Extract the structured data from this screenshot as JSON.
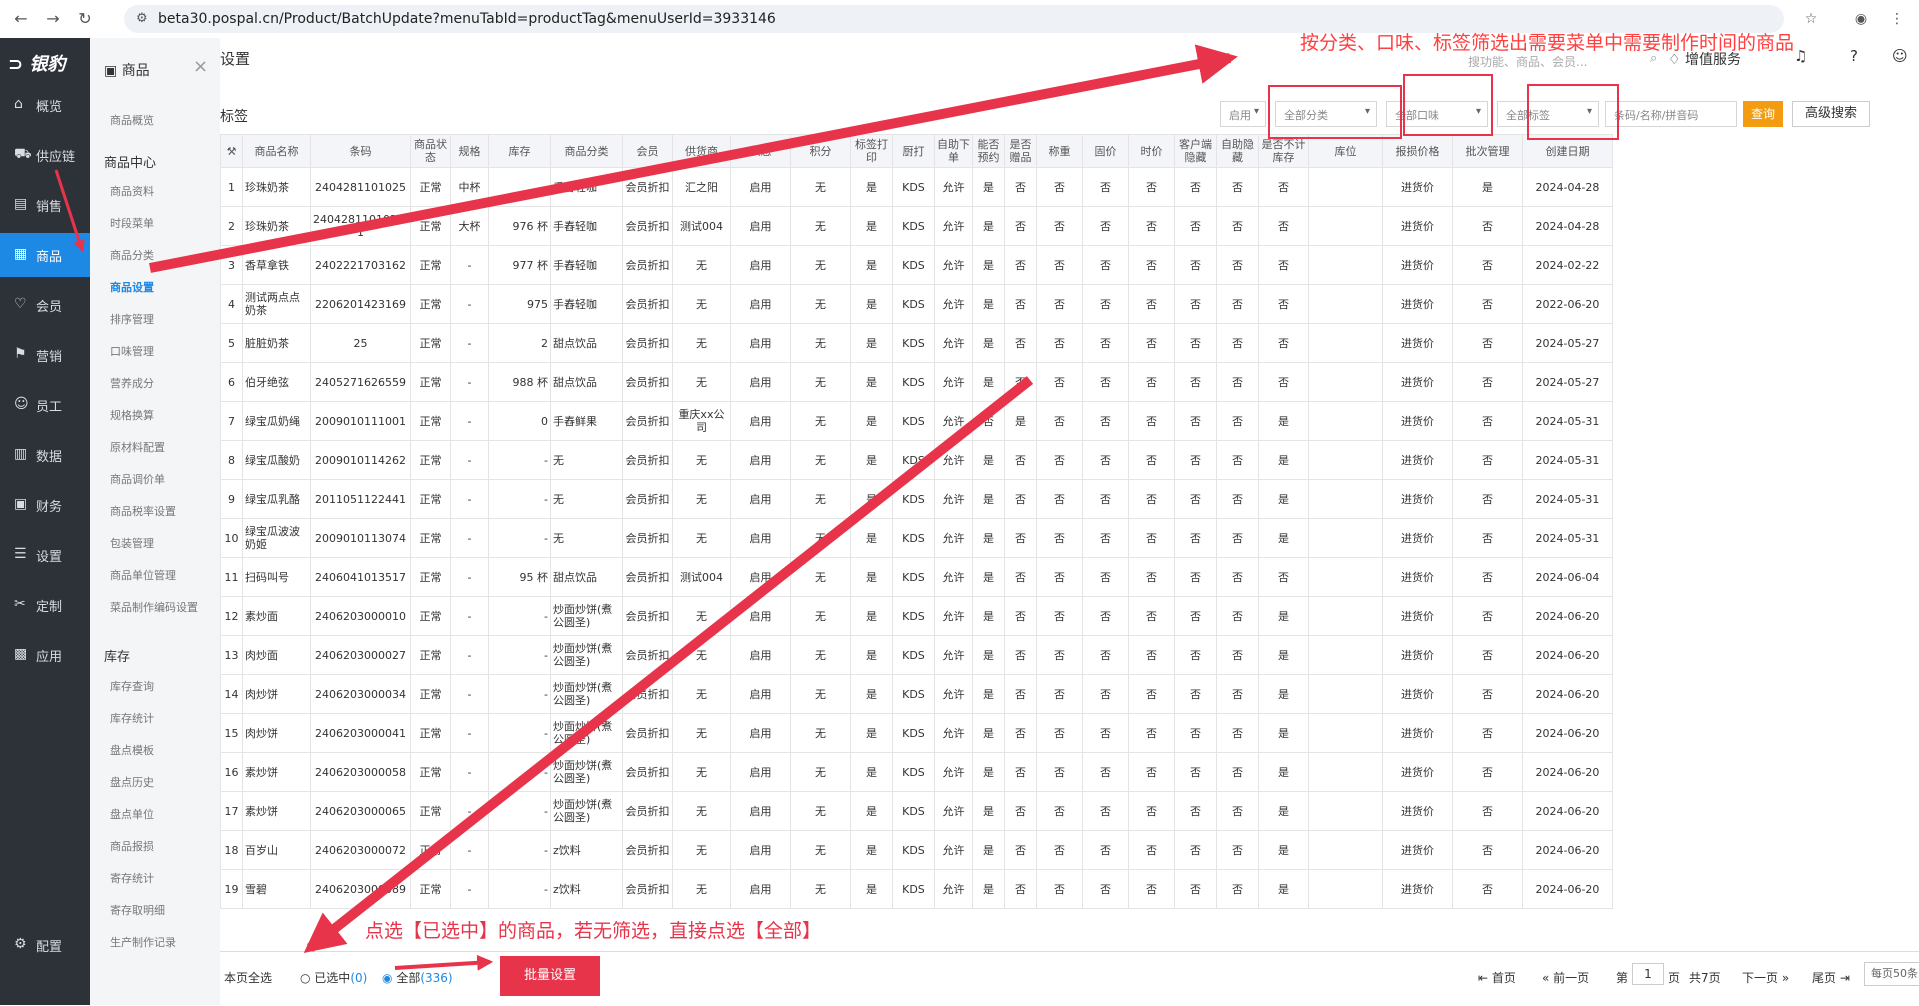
{
  "browser": {
    "url": "beta30.pospal.cn/Product/BatchUpdate?menuTabId=productTag&menuUserId=3933146"
  },
  "logo": "银豹",
  "nav": [
    {
      "label": "概览",
      "icon": "⌂"
    },
    {
      "label": "供应链",
      "icon": "⛟"
    },
    {
      "label": "销售",
      "icon": "▤"
    },
    {
      "label": "商品",
      "icon": "▦"
    },
    {
      "label": "会员",
      "icon": "♡"
    },
    {
      "label": "营销",
      "icon": "⚑"
    },
    {
      "label": "员工",
      "icon": "☺"
    },
    {
      "label": "数据",
      "icon": "▥"
    },
    {
      "label": "财务",
      "icon": "▣"
    },
    {
      "label": "设置",
      "icon": "☰"
    },
    {
      "label": "定制",
      "icon": "✂"
    },
    {
      "label": "应用",
      "icon": "▩"
    },
    {
      "label": "配置",
      "icon": "⚙"
    }
  ],
  "sub": {
    "title": "商品",
    "close": "×",
    "top": "商品概览",
    "center_head": "商品中心",
    "center": [
      "商品资料",
      "时段菜单",
      "商品分类",
      "商品设置",
      "排序管理",
      "口味管理",
      "营养成分",
      "规格换算",
      "原材料配置",
      "商品调价单",
      "商品税率设置",
      "包装管理",
      "商品单位管理",
      "菜品制作编码设置"
    ],
    "stock_head": "库存",
    "stock": [
      "库存查询",
      "库存统计",
      "盘点模板",
      "盘点历史",
      "盘点单位",
      "商品报损",
      "寄存统计",
      "寄存取明细",
      "生产制作记录"
    ]
  },
  "header": {
    "crumb": "设置",
    "sublabel": "标签",
    "search_placeholder": "搜功能、商品、会员...",
    "vip": "增值服务",
    "f_status": "启用",
    "f_cat": "全部分类",
    "f_flavor": "全部口味",
    "f_tag": "全部标签",
    "f_search": "条码/名称/拼音码",
    "query": "查询",
    "adv": "高级搜索"
  },
  "columns": [
    "",
    "商品名称",
    "条码",
    "商品状态",
    "规格",
    "库存",
    "商品分类",
    "会员",
    "供货商",
    "状态",
    "积分",
    "标签打印",
    "厨打",
    "自助下单",
    "能否预约",
    "是否赠品",
    "称重",
    "固价",
    "时价",
    "客户端隐藏",
    "自助隐藏",
    "是否不计库存",
    "库位",
    "报损价格",
    "批次管理",
    "创建日期"
  ],
  "rows": [
    [
      "1",
      "珍珠奶茶",
      "2404281101025",
      "正常",
      "中杯",
      "-",
      "手舂轻咖",
      "会员折扣",
      "汇之阳",
      "启用",
      "无",
      "是",
      "KDS",
      "允许",
      "是",
      "否",
      "否",
      "否",
      "否",
      "否",
      "否",
      "否",
      "",
      "进货价",
      "是",
      "2024-04-28"
    ],
    [
      "2",
      "珍珠奶茶",
      "2404281101025-1",
      "正常",
      "大杯",
      "976 杯",
      "手舂轻咖",
      "会员折扣",
      "测试004",
      "启用",
      "无",
      "是",
      "KDS",
      "允许",
      "是",
      "否",
      "否",
      "否",
      "否",
      "否",
      "否",
      "否",
      "",
      "进货价",
      "否",
      "2024-04-28"
    ],
    [
      "3",
      "香草拿铁",
      "2402221703162",
      "正常",
      "-",
      "977 杯",
      "手舂轻咖",
      "会员折扣",
      "无",
      "启用",
      "无",
      "是",
      "KDS",
      "允许",
      "是",
      "否",
      "否",
      "否",
      "否",
      "否",
      "否",
      "否",
      "",
      "进货价",
      "否",
      "2024-02-22"
    ],
    [
      "4",
      "测试两点点奶茶",
      "2206201423169",
      "正常",
      "-",
      "975",
      "手舂轻咖",
      "会员折扣",
      "无",
      "启用",
      "无",
      "是",
      "KDS",
      "允许",
      "是",
      "否",
      "否",
      "否",
      "否",
      "否",
      "否",
      "否",
      "",
      "进货价",
      "否",
      "2022-06-20"
    ],
    [
      "5",
      "脏脏奶茶",
      "25",
      "正常",
      "-",
      "2",
      "甜点饮品",
      "会员折扣",
      "无",
      "启用",
      "无",
      "是",
      "KDS",
      "允许",
      "是",
      "否",
      "否",
      "否",
      "否",
      "否",
      "否",
      "否",
      "",
      "进货价",
      "否",
      "2024-05-27"
    ],
    [
      "6",
      "伯牙绝弦",
      "2405271626559",
      "正常",
      "-",
      "988 杯",
      "甜点饮品",
      "会员折扣",
      "无",
      "启用",
      "无",
      "是",
      "KDS",
      "允许",
      "是",
      "否",
      "否",
      "否",
      "否",
      "否",
      "否",
      "否",
      "",
      "进货价",
      "否",
      "2024-05-27"
    ],
    [
      "7",
      "绿宝瓜奶绳",
      "2009010111001",
      "正常",
      "-",
      "0",
      "手舂鲜果",
      "会员折扣",
      "重庆xx公司",
      "启用",
      "无",
      "是",
      "KDS",
      "允许",
      "否",
      "是",
      "否",
      "否",
      "否",
      "否",
      "否",
      "是",
      "",
      "进货价",
      "否",
      "2024-05-31"
    ],
    [
      "8",
      "绿宝瓜酸奶",
      "2009010114262",
      "正常",
      "-",
      "-",
      "无",
      "会员折扣",
      "无",
      "启用",
      "无",
      "是",
      "KDS",
      "允许",
      "是",
      "否",
      "否",
      "否",
      "否",
      "否",
      "否",
      "是",
      "",
      "进货价",
      "否",
      "2024-05-31"
    ],
    [
      "9",
      "绿宝瓜乳酪",
      "2011051122441",
      "正常",
      "-",
      "-",
      "无",
      "会员折扣",
      "无",
      "启用",
      "无",
      "是",
      "KDS",
      "允许",
      "是",
      "否",
      "否",
      "否",
      "否",
      "否",
      "否",
      "是",
      "",
      "进货价",
      "否",
      "2024-05-31"
    ],
    [
      "10",
      "绿宝瓜波波奶姬",
      "2009010113074",
      "正常",
      "-",
      "-",
      "无",
      "会员折扣",
      "无",
      "启用",
      "无",
      "是",
      "KDS",
      "允许",
      "是",
      "否",
      "否",
      "否",
      "否",
      "否",
      "否",
      "是",
      "",
      "进货价",
      "否",
      "2024-05-31"
    ],
    [
      "11",
      "扫码叫号",
      "2406041013517",
      "正常",
      "-",
      "95 杯",
      "甜点饮品",
      "会员折扣",
      "测试004",
      "启用",
      "无",
      "是",
      "KDS",
      "允许",
      "是",
      "否",
      "否",
      "否",
      "否",
      "否",
      "否",
      "否",
      "",
      "进货价",
      "否",
      "2024-06-04"
    ],
    [
      "12",
      "素炒面",
      "2406203000010",
      "正常",
      "-",
      "-",
      "炒面炒饼(煮公圆圣)",
      "会员折扣",
      "无",
      "启用",
      "无",
      "是",
      "KDS",
      "允许",
      "是",
      "否",
      "否",
      "否",
      "否",
      "否",
      "否",
      "是",
      "",
      "进货价",
      "否",
      "2024-06-20"
    ],
    [
      "13",
      "肉炒面",
      "2406203000027",
      "正常",
      "-",
      "-",
      "炒面炒饼(煮公圆圣)",
      "会员折扣",
      "无",
      "启用",
      "无",
      "是",
      "KDS",
      "允许",
      "是",
      "否",
      "否",
      "否",
      "否",
      "否",
      "否",
      "是",
      "",
      "进货价",
      "否",
      "2024-06-20"
    ],
    [
      "14",
      "肉炒饼",
      "2406203000034",
      "正常",
      "-",
      "-",
      "炒面炒饼(煮公圆圣)",
      "会员折扣",
      "无",
      "启用",
      "无",
      "是",
      "KDS",
      "允许",
      "是",
      "否",
      "否",
      "否",
      "否",
      "否",
      "否",
      "是",
      "",
      "进货价",
      "否",
      "2024-06-20"
    ],
    [
      "15",
      "肉炒饼",
      "2406203000041",
      "正常",
      "-",
      "-",
      "炒面炒饼(煮公圆圣)",
      "会员折扣",
      "无",
      "启用",
      "无",
      "是",
      "KDS",
      "允许",
      "是",
      "否",
      "否",
      "否",
      "否",
      "否",
      "否",
      "是",
      "",
      "进货价",
      "否",
      "2024-06-20"
    ],
    [
      "16",
      "素炒饼",
      "2406203000058",
      "正常",
      "-",
      "-",
      "炒面炒饼(煮公圆圣)",
      "会员折扣",
      "无",
      "启用",
      "无",
      "是",
      "KDS",
      "允许",
      "是",
      "否",
      "否",
      "否",
      "否",
      "否",
      "否",
      "是",
      "",
      "进货价",
      "否",
      "2024-06-20"
    ],
    [
      "17",
      "素炒饼",
      "2406203000065",
      "正常",
      "-",
      "-",
      "炒面炒饼(煮公圆圣)",
      "会员折扣",
      "无",
      "启用",
      "无",
      "是",
      "KDS",
      "允许",
      "是",
      "否",
      "否",
      "否",
      "否",
      "否",
      "否",
      "是",
      "",
      "进货价",
      "否",
      "2024-06-20"
    ],
    [
      "18",
      "百岁山",
      "2406203000072",
      "正常",
      "-",
      "-",
      "z饮料",
      "会员折扣",
      "无",
      "启用",
      "无",
      "是",
      "KDS",
      "允许",
      "是",
      "否",
      "否",
      "否",
      "否",
      "否",
      "否",
      "是",
      "",
      "进货价",
      "否",
      "2024-06-20"
    ],
    [
      "19",
      "雪碧",
      "2406203000089",
      "正常",
      "-",
      "-",
      "z饮料",
      "会员折扣",
      "无",
      "启用",
      "无",
      "是",
      "KDS",
      "允许",
      "是",
      "否",
      "否",
      "否",
      "否",
      "否",
      "否",
      "是",
      "",
      "进货价",
      "否",
      "2024-06-20"
    ]
  ],
  "footer": {
    "pageall": "本页全选",
    "selected": "已选中",
    "sel_count": "(0)",
    "all": "全部",
    "all_count": "(336)",
    "batch": "批量设置",
    "first": "首页",
    "prev": "前一页",
    "page_pre": "第",
    "page": "1",
    "page_suf": "页",
    "total": "共7页",
    "next": "下一页",
    "last": "尾页",
    "per": "每页50条"
  },
  "annotations": {
    "top": "按分类、口味、标签筛选出需要菜单中需要制作时间的商品",
    "bottom": "点选【已选中】的商品，若无筛选，直接点选【全部】"
  },
  "colors": {
    "accent": "#1e88e5",
    "annotation": "#e8344a",
    "query": "#f39c12"
  }
}
